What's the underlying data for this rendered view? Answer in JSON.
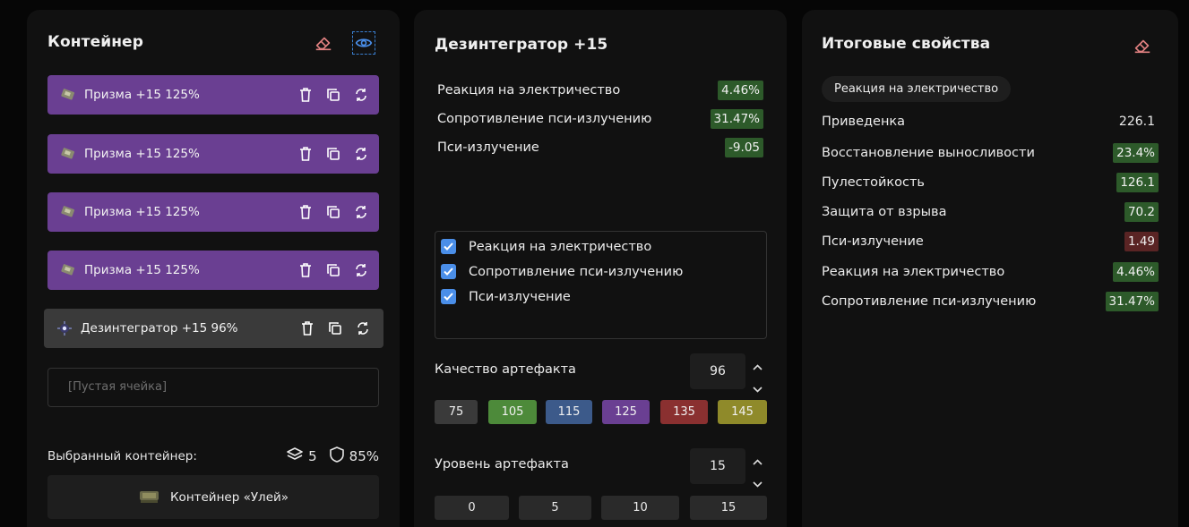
{
  "container_panel": {
    "title": "Контейнер",
    "items": [
      {
        "label": "Призма +15 125%"
      },
      {
        "label": "Призма +15 125%"
      },
      {
        "label": "Призма +15 125%"
      },
      {
        "label": "Призма +15 125%"
      },
      {
        "label": "Дезинтегратор +15 96%"
      }
    ],
    "empty_slot": "[Пустая ячейка]",
    "selected_label": "Выбранный контейнер:",
    "slots": "5",
    "protection": "85%",
    "container_button": "Контейнер «Улей»"
  },
  "artifact_panel": {
    "title": "Дезинтегратор +15",
    "stats": [
      {
        "name": "Реакция на электричество",
        "value": "4.46%",
        "tone": "green"
      },
      {
        "name": "Сопротивление пси-излучению",
        "value": "31.47%",
        "tone": "green"
      },
      {
        "name": "Пси-излучение",
        "value": "-9.05",
        "tone": "green"
      }
    ],
    "checkboxes": [
      {
        "label": "Реакция на электричество",
        "checked": true
      },
      {
        "label": "Сопротивление пси-излучению",
        "checked": true
      },
      {
        "label": "Пси-излучение",
        "checked": true
      }
    ],
    "quality_label": "Качество артефакта",
    "quality_value": "96",
    "quality_presets": [
      {
        "label": "75",
        "color": "#3a3a3a"
      },
      {
        "label": "105",
        "color": "#4d8a3a"
      },
      {
        "label": "115",
        "color": "#3c5a8a"
      },
      {
        "label": "125",
        "color": "#6a3f92"
      },
      {
        "label": "135",
        "color": "#8a3030"
      },
      {
        "label": "145",
        "color": "#8f8a2a"
      }
    ],
    "level_label": "Уровень артефакта",
    "level_value": "15",
    "level_presets": [
      "0",
      "5",
      "10",
      "15"
    ]
  },
  "totals_panel": {
    "title": "Итоговые свойства",
    "filter_chip": "Реакция на электричество",
    "rows": [
      {
        "name": "Приведенка",
        "value": "226.1",
        "tone": "plain"
      },
      {
        "name": "Восстановление выносливости",
        "value": "23.4%",
        "tone": "green"
      },
      {
        "name": "Пулестойкость",
        "value": "126.1",
        "tone": "green"
      },
      {
        "name": "Защита от взрыва",
        "value": "70.2",
        "tone": "green"
      },
      {
        "name": "Пси-излучение",
        "value": "1.49",
        "tone": "red"
      },
      {
        "name": "Реакция на электричество",
        "value": "4.46%",
        "tone": "green"
      },
      {
        "name": "Сопротивление пси-излучению",
        "value": "31.47%",
        "tone": "green"
      }
    ]
  },
  "colors": {
    "accent_blue": "#4a8ee8",
    "purple": "#6a3f92",
    "eraser": "#e08080",
    "positive": "#2d5a2a",
    "negative": "#5a2424"
  }
}
